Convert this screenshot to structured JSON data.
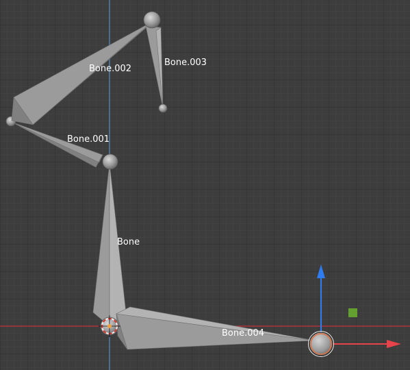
{
  "viewport": {
    "bone_labels": {
      "bone": "Bone",
      "bone_001": "Bone.001",
      "bone_002": "Bone.002",
      "bone_003": "Bone.003",
      "bone_004": "Bone.004"
    },
    "axis_colors": {
      "x_axis": "#c8323c",
      "y_axis": "#2e78d6",
      "z_axis": "#5ea0e8",
      "gizmo_x": "#e8424a",
      "gizmo_y": "#2f7cf0",
      "gizmo_center": "#64a030"
    },
    "icons": [
      "3d-cursor-icon",
      "move-gizmo-x-arrow-icon",
      "move-gizmo-y-arrow-icon",
      "move-gizmo-plane-handle-icon"
    ]
  }
}
